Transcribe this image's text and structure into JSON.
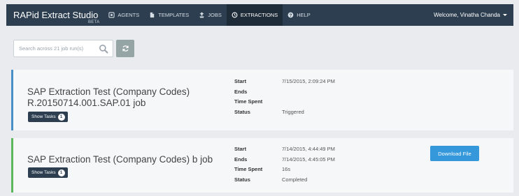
{
  "navbar": {
    "brand_title": "RAPid Extract Studio",
    "brand_sub": "BETA",
    "items": [
      {
        "label": "AGENTS",
        "icon": "agents-icon"
      },
      {
        "label": "TEMPLATES",
        "icon": "templates-icon"
      },
      {
        "label": "JOBS",
        "icon": "jobs-icon"
      },
      {
        "label": "EXTRACTIONS",
        "icon": "extractions-icon",
        "active": true
      },
      {
        "label": "HELP",
        "icon": "help-icon"
      }
    ],
    "user_label": "Welcome, Vinatha Chanda"
  },
  "search": {
    "placeholder": "Search across 21 job run(s)",
    "value": ""
  },
  "jobs": [
    {
      "title_line1": "SAP Extraction Test (Company Codes)",
      "title_line2": "R.20150714.001.SAP.01 job",
      "show_tasks_label": "Show Tasks",
      "task_count": "1",
      "labels": {
        "start": "Start",
        "ends": "Ends",
        "time_spent": "Time Spent",
        "status": "Status"
      },
      "start": "7/15/2015, 2:09:24 PM",
      "ends": "",
      "time_spent": "",
      "status": "Triggered",
      "status_color": "#4a90c8"
    },
    {
      "title": "SAP Extraction Test (Company Codes) b job",
      "show_tasks_label": "Show Tasks",
      "task_count": "1",
      "labels": {
        "start": "Start",
        "ends": "Ends",
        "time_spent": "Time Spent",
        "status": "Status"
      },
      "start": "7/14/2015, 4:44:49 PM",
      "ends": "7/14/2015, 4:45:05 PM",
      "time_spent": "16s",
      "status": "Completed",
      "status_color": "#5cb85c",
      "download_label": "Download File"
    }
  ],
  "colors": {
    "navbar_bg": "#2c3e50",
    "page_bg": "#e9ebee",
    "card_bg": "#f6f7f8",
    "accent_blue": "#3498db",
    "refresh_btn": "#95a5a6"
  }
}
